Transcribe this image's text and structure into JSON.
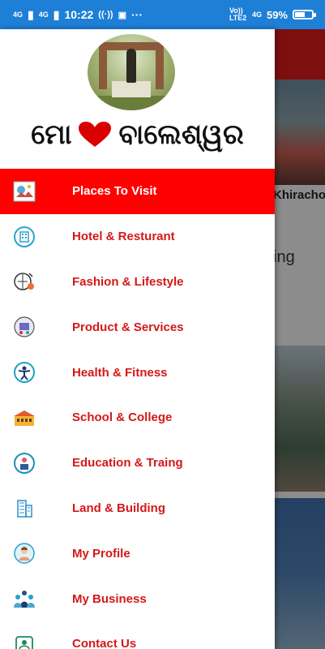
{
  "status_bar": {
    "signal1": "4G",
    "signal2": "4G",
    "time": "10:22",
    "more": "···",
    "volte": "Vo)) LTE2",
    "net": "4G",
    "battery": "59%",
    "battery_level": 59,
    "bg_color": "#1e7fd6"
  },
  "drawer": {
    "brand": {
      "left_text": "ମୋ",
      "right_text": "ବାଲେଶ୍ୱର",
      "heart_color": "#d90000"
    },
    "menu": [
      {
        "label": "Places To Visit",
        "icon": "places-icon",
        "active": true
      },
      {
        "label": "Hotel & Resturant",
        "icon": "hotel-icon",
        "active": false
      },
      {
        "label": "Fashion & Lifestyle",
        "icon": "fashion-icon",
        "active": false
      },
      {
        "label": "Product & Services",
        "icon": "product-icon",
        "active": false
      },
      {
        "label": "Health & Fitness",
        "icon": "fitness-icon",
        "active": false
      },
      {
        "label": "School & College",
        "icon": "school-icon",
        "active": false
      },
      {
        "label": "Education & Traing",
        "icon": "education-icon",
        "active": false
      },
      {
        "label": "Land & Building",
        "icon": "building-icon",
        "active": false
      },
      {
        "label": "My Profile",
        "icon": "profile-icon",
        "active": false
      },
      {
        "label": "My Business",
        "icon": "business-icon",
        "active": false
      },
      {
        "label": "Contact Us",
        "icon": "contact-icon",
        "active": false
      }
    ],
    "accent": "#ff0000",
    "label_color": "#d51818"
  },
  "background": {
    "text1": "Khiracho",
    "text2": "ing"
  }
}
